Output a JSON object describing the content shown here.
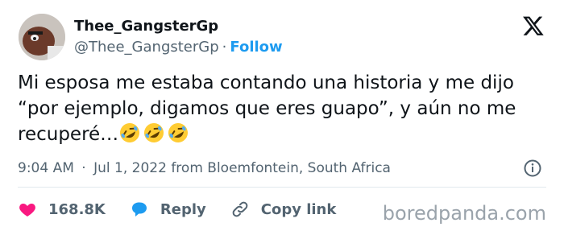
{
  "author": {
    "name": "Thee_GangsterGp",
    "handle": "@Thee_GangsterGp",
    "separator": "·",
    "follow_label": "Follow"
  },
  "tweet": {
    "text": "Mi esposa me estaba contando una historia y me dijo “por ejemplo, digamos que eres guapo”, y aún no me recuperé…",
    "emoji": "🤣🤣🤣"
  },
  "meta": {
    "time": "9:04 AM",
    "separator": "·",
    "date": "Jul 1, 2022 from Bloemfontein, South Africa"
  },
  "actions": {
    "likes": "168.8K",
    "reply_label": "Reply",
    "copy_link_label": "Copy link"
  },
  "watermark": "boredpanda.com",
  "icons": {
    "heart": "heart-icon",
    "reply": "reply-icon",
    "link": "link-icon",
    "info": "info-icon",
    "x_logo": "x-logo-icon"
  },
  "colors": {
    "link_blue": "#1d9bf0",
    "heart_pink": "#f91880",
    "text": "#0f1419",
    "muted": "#536471"
  }
}
